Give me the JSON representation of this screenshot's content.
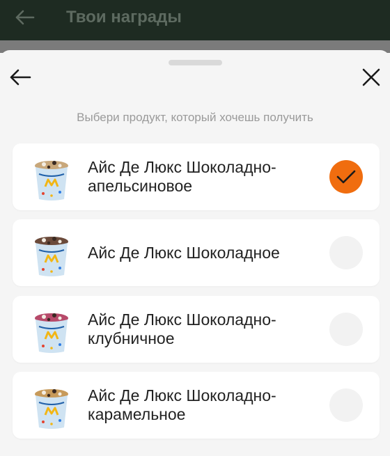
{
  "header": {
    "title": "Твои награды",
    "background": "#1e2b22",
    "back_icon": "arrow-left-icon"
  },
  "sheet": {
    "subtitle": "Выбери продукт, который хочешь получить",
    "back_icon": "arrow-left-icon",
    "close_icon": "close-icon",
    "accent": "#f06d0f"
  },
  "products": [
    {
      "line1": "Айс Де Люкс",
      "line2": "Шоколадно-апельсиновое",
      "selected": true,
      "topping": "#c8a77a"
    },
    {
      "line1": "Айс Де Люкс",
      "line2": "Шоколадное",
      "selected": false,
      "topping": "#6b4a3a"
    },
    {
      "line1": "Айс Де Люкс",
      "line2": "Шоколадно-клубничное",
      "selected": false,
      "topping": "#b74a6a"
    },
    {
      "line1": "Айс Де Люкс",
      "line2": "Шоколадно-карамельное",
      "selected": false,
      "topping": "#c79a5a"
    }
  ]
}
